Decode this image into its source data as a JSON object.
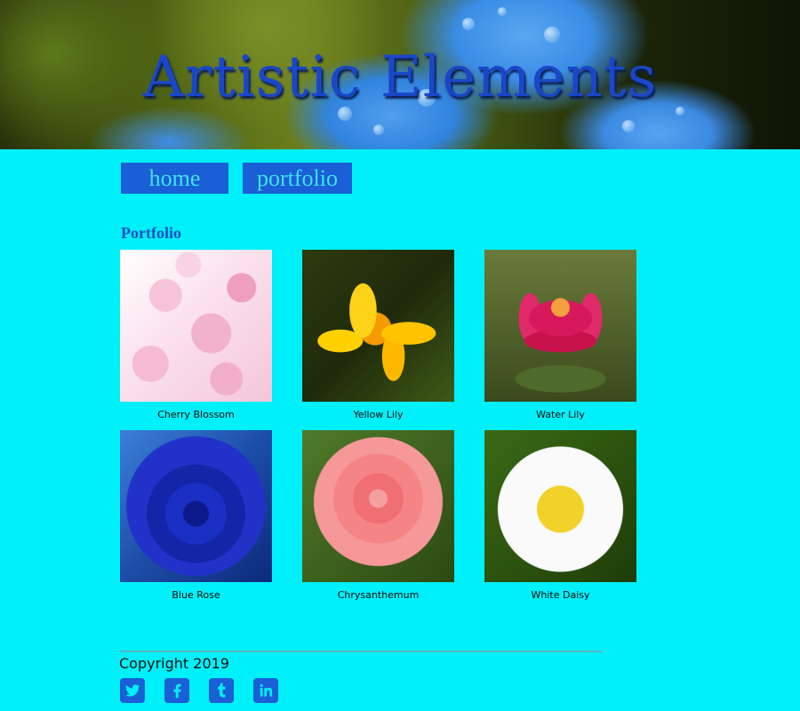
{
  "site": {
    "title": "Artistic Elements"
  },
  "nav": {
    "items": [
      {
        "label": "home"
      },
      {
        "label": "portfolio"
      }
    ]
  },
  "section": {
    "title": "Portfolio"
  },
  "gallery": {
    "items": [
      {
        "caption": "Cherry Blossom"
      },
      {
        "caption": "Yellow Lily"
      },
      {
        "caption": "Water Lily"
      },
      {
        "caption": "Blue Rose"
      },
      {
        "caption": "Chrysanthemum"
      },
      {
        "caption": "White Daisy"
      }
    ]
  },
  "footer": {
    "copyright": "Copyright 2019",
    "social": [
      {
        "icon": "twitter-icon"
      },
      {
        "icon": "facebook-icon"
      },
      {
        "icon": "tumblr-icon"
      },
      {
        "icon": "linkedin-icon"
      }
    ]
  },
  "colors": {
    "page_background": "#00f0fa",
    "accent_blue": "#1a5fd6",
    "title_blue": "#1a47c9"
  }
}
